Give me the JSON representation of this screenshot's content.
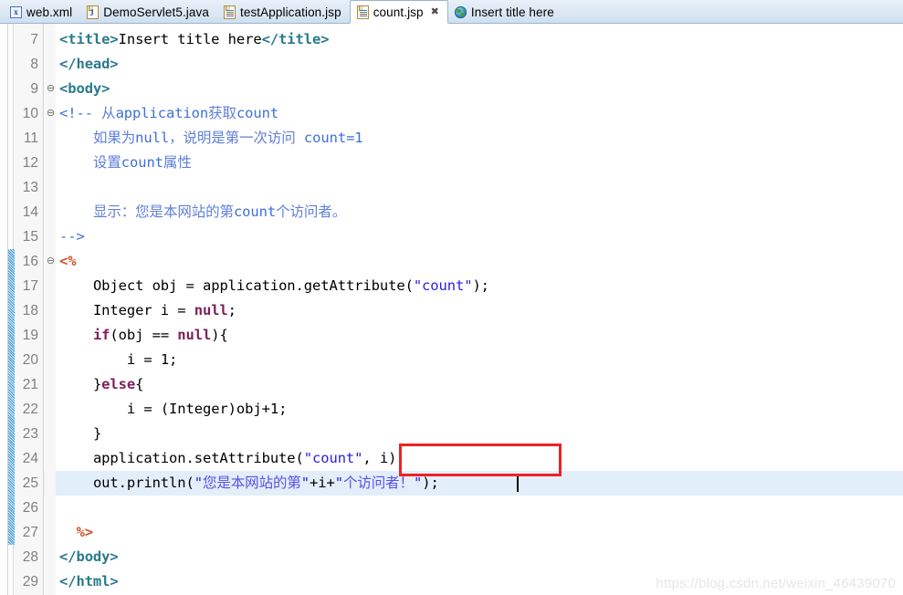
{
  "tabs": [
    {
      "label": "web.xml",
      "icon": "xml-file-icon",
      "active": false,
      "closable": false
    },
    {
      "label": "DemoServlet5.java",
      "icon": "java-file-icon",
      "active": false,
      "closable": false
    },
    {
      "label": "testApplication.jsp",
      "icon": "jsp-file-icon",
      "active": false,
      "closable": false
    },
    {
      "label": "count.jsp",
      "icon": "jsp-file-icon",
      "active": true,
      "closable": true,
      "close_glyph": "✖"
    },
    {
      "label": "Insert title here",
      "icon": "globe-icon",
      "active": false,
      "closable": false
    }
  ],
  "editor": {
    "first_line": 7,
    "current_line": 25,
    "fold_marker": "⊖",
    "lines": [
      {
        "no": 7,
        "fold": false,
        "text": "<title>Insert title here</title>"
      },
      {
        "no": 8,
        "fold": false,
        "text": "</head>"
      },
      {
        "no": 9,
        "fold": true,
        "text": "<body>"
      },
      {
        "no": 10,
        "fold": true,
        "text": "<!-- 从application获取count"
      },
      {
        "no": 11,
        "fold": false,
        "text": "    如果为null，说明是第一次访问 count=1"
      },
      {
        "no": 12,
        "fold": false,
        "text": "    设置count属性"
      },
      {
        "no": 13,
        "fold": false,
        "text": ""
      },
      {
        "no": 14,
        "fold": false,
        "text": "    显示：您是本网站的第count个访问者。"
      },
      {
        "no": 15,
        "fold": false,
        "text": "-->"
      },
      {
        "no": 16,
        "fold": true,
        "text": "<%"
      },
      {
        "no": 17,
        "fold": false,
        "text": "    Object obj = application.getAttribute(\"count\");"
      },
      {
        "no": 18,
        "fold": false,
        "text": "    Integer i = null;"
      },
      {
        "no": 19,
        "fold": false,
        "text": "    if(obj == null){"
      },
      {
        "no": 20,
        "fold": false,
        "text": "        i = 1;"
      },
      {
        "no": 21,
        "fold": false,
        "text": "    }else{"
      },
      {
        "no": 22,
        "fold": false,
        "text": "        i = (Integer)obj+1;"
      },
      {
        "no": 23,
        "fold": false,
        "text": "    }"
      },
      {
        "no": 24,
        "fold": false,
        "text": "    application.setAttribute(\"count\", i);"
      },
      {
        "no": 25,
        "fold": false,
        "text": "    out.println(\"您是本网站的第\"+i+\"个访问者！\");"
      },
      {
        "no": 26,
        "fold": false,
        "text": ""
      },
      {
        "no": 27,
        "fold": false,
        "text": "  %>"
      },
      {
        "no": 28,
        "fold": false,
        "text": "</body>"
      },
      {
        "no": 29,
        "fold": false,
        "text": "</html>"
      }
    ]
  },
  "annotation": {
    "type": "red-rectangle",
    "color": "#ef2222",
    "targets": "\"count\", i);"
  },
  "watermark": {
    "text": "https://blog.csdn.net/weixin_46439070",
    "color": "#e6e6e6"
  },
  "colors": {
    "tag": "#2a7a8c",
    "comment": "#3f6fd8",
    "scriptlet": "#d2502a",
    "keyword": "#7a1f5c",
    "string": "#2a1ee0",
    "current_line_highlight": "#e3eefb",
    "change_bar": "#4a9fd6"
  }
}
